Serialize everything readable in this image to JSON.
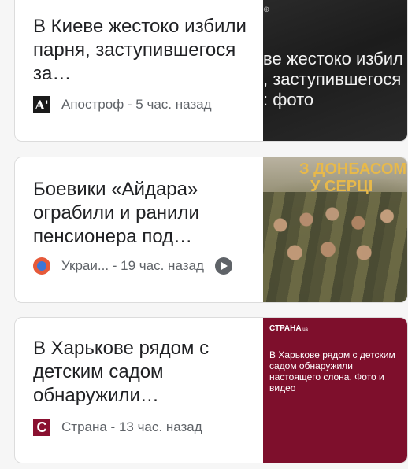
{
  "cards": [
    {
      "headline": "В Киеве жестоко избили парня, заступившегося за…",
      "source": "Апостроф",
      "time": "5 час. назад",
      "source_icon_letter": "A'",
      "thumb_logo": "⊕",
      "thumb_overlay_lines": [
        "ве жестоко избил",
        ", заступившегося",
        ": фото"
      ]
    },
    {
      "headline": "Боевики «Айдара» ограбили и ранили пенсионера под…",
      "source": "Украи...",
      "time": "19 час. назад",
      "thumb_banner_lines": [
        "З ДОНБАСОМ",
        "У СЕРЦІ"
      ],
      "has_video": true
    },
    {
      "headline": "В Харькове рядом с детским садом обнаружили…",
      "source": "Страна",
      "time": "13 час. назад",
      "source_icon_letter": "С",
      "thumb_brand": "СТРАНА",
      "thumb_brand_suffix": ".ua",
      "thumb_blurb": "В Харькове рядом с детским садом обнаружили настоящего слона. Фото и видео"
    }
  ],
  "colors": {
    "strana_brand": "#7e0f2c",
    "ukr_icon_outer": "#e65a3a",
    "ukr_icon_inner": "#3b76d8"
  },
  "separator": " - "
}
